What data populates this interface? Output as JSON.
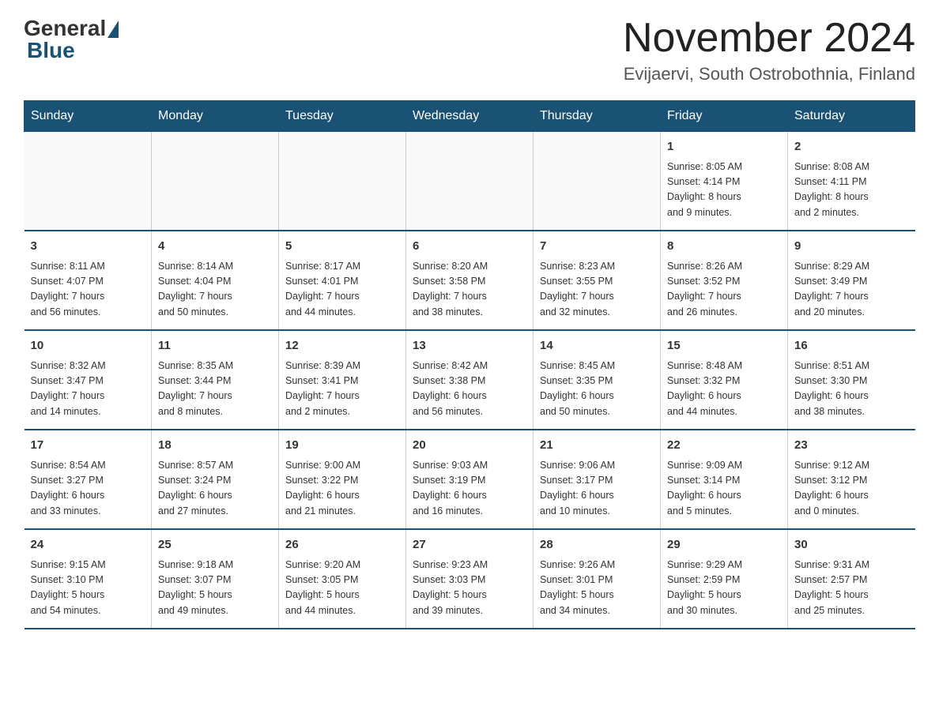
{
  "header": {
    "logo_general": "General",
    "logo_blue": "Blue",
    "month_title": "November 2024",
    "location": "Evijaervi, South Ostrobothnia, Finland"
  },
  "days_of_week": [
    "Sunday",
    "Monday",
    "Tuesday",
    "Wednesday",
    "Thursday",
    "Friday",
    "Saturday"
  ],
  "weeks": [
    [
      {
        "day": "",
        "info": ""
      },
      {
        "day": "",
        "info": ""
      },
      {
        "day": "",
        "info": ""
      },
      {
        "day": "",
        "info": ""
      },
      {
        "day": "",
        "info": ""
      },
      {
        "day": "1",
        "info": "Sunrise: 8:05 AM\nSunset: 4:14 PM\nDaylight: 8 hours\nand 9 minutes."
      },
      {
        "day": "2",
        "info": "Sunrise: 8:08 AM\nSunset: 4:11 PM\nDaylight: 8 hours\nand 2 minutes."
      }
    ],
    [
      {
        "day": "3",
        "info": "Sunrise: 8:11 AM\nSunset: 4:07 PM\nDaylight: 7 hours\nand 56 minutes."
      },
      {
        "day": "4",
        "info": "Sunrise: 8:14 AM\nSunset: 4:04 PM\nDaylight: 7 hours\nand 50 minutes."
      },
      {
        "day": "5",
        "info": "Sunrise: 8:17 AM\nSunset: 4:01 PM\nDaylight: 7 hours\nand 44 minutes."
      },
      {
        "day": "6",
        "info": "Sunrise: 8:20 AM\nSunset: 3:58 PM\nDaylight: 7 hours\nand 38 minutes."
      },
      {
        "day": "7",
        "info": "Sunrise: 8:23 AM\nSunset: 3:55 PM\nDaylight: 7 hours\nand 32 minutes."
      },
      {
        "day": "8",
        "info": "Sunrise: 8:26 AM\nSunset: 3:52 PM\nDaylight: 7 hours\nand 26 minutes."
      },
      {
        "day": "9",
        "info": "Sunrise: 8:29 AM\nSunset: 3:49 PM\nDaylight: 7 hours\nand 20 minutes."
      }
    ],
    [
      {
        "day": "10",
        "info": "Sunrise: 8:32 AM\nSunset: 3:47 PM\nDaylight: 7 hours\nand 14 minutes."
      },
      {
        "day": "11",
        "info": "Sunrise: 8:35 AM\nSunset: 3:44 PM\nDaylight: 7 hours\nand 8 minutes."
      },
      {
        "day": "12",
        "info": "Sunrise: 8:39 AM\nSunset: 3:41 PM\nDaylight: 7 hours\nand 2 minutes."
      },
      {
        "day": "13",
        "info": "Sunrise: 8:42 AM\nSunset: 3:38 PM\nDaylight: 6 hours\nand 56 minutes."
      },
      {
        "day": "14",
        "info": "Sunrise: 8:45 AM\nSunset: 3:35 PM\nDaylight: 6 hours\nand 50 minutes."
      },
      {
        "day": "15",
        "info": "Sunrise: 8:48 AM\nSunset: 3:32 PM\nDaylight: 6 hours\nand 44 minutes."
      },
      {
        "day": "16",
        "info": "Sunrise: 8:51 AM\nSunset: 3:30 PM\nDaylight: 6 hours\nand 38 minutes."
      }
    ],
    [
      {
        "day": "17",
        "info": "Sunrise: 8:54 AM\nSunset: 3:27 PM\nDaylight: 6 hours\nand 33 minutes."
      },
      {
        "day": "18",
        "info": "Sunrise: 8:57 AM\nSunset: 3:24 PM\nDaylight: 6 hours\nand 27 minutes."
      },
      {
        "day": "19",
        "info": "Sunrise: 9:00 AM\nSunset: 3:22 PM\nDaylight: 6 hours\nand 21 minutes."
      },
      {
        "day": "20",
        "info": "Sunrise: 9:03 AM\nSunset: 3:19 PM\nDaylight: 6 hours\nand 16 minutes."
      },
      {
        "day": "21",
        "info": "Sunrise: 9:06 AM\nSunset: 3:17 PM\nDaylight: 6 hours\nand 10 minutes."
      },
      {
        "day": "22",
        "info": "Sunrise: 9:09 AM\nSunset: 3:14 PM\nDaylight: 6 hours\nand 5 minutes."
      },
      {
        "day": "23",
        "info": "Sunrise: 9:12 AM\nSunset: 3:12 PM\nDaylight: 6 hours\nand 0 minutes."
      }
    ],
    [
      {
        "day": "24",
        "info": "Sunrise: 9:15 AM\nSunset: 3:10 PM\nDaylight: 5 hours\nand 54 minutes."
      },
      {
        "day": "25",
        "info": "Sunrise: 9:18 AM\nSunset: 3:07 PM\nDaylight: 5 hours\nand 49 minutes."
      },
      {
        "day": "26",
        "info": "Sunrise: 9:20 AM\nSunset: 3:05 PM\nDaylight: 5 hours\nand 44 minutes."
      },
      {
        "day": "27",
        "info": "Sunrise: 9:23 AM\nSunset: 3:03 PM\nDaylight: 5 hours\nand 39 minutes."
      },
      {
        "day": "28",
        "info": "Sunrise: 9:26 AM\nSunset: 3:01 PM\nDaylight: 5 hours\nand 34 minutes."
      },
      {
        "day": "29",
        "info": "Sunrise: 9:29 AM\nSunset: 2:59 PM\nDaylight: 5 hours\nand 30 minutes."
      },
      {
        "day": "30",
        "info": "Sunrise: 9:31 AM\nSunset: 2:57 PM\nDaylight: 5 hours\nand 25 minutes."
      }
    ]
  ]
}
